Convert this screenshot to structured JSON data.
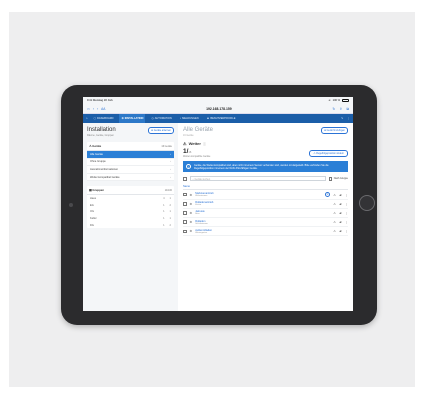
{
  "statusbar": {
    "time": "9:41",
    "date": "Dienstag 18. Feb.",
    "battery": "100 %"
  },
  "browser": {
    "url": "192.168.178.159",
    "aa_label": "AA"
  },
  "nav": {
    "tabs": [
      {
        "label": "DASHBOARD"
      },
      {
        "label": "INSTALLATION",
        "active": true
      },
      {
        "label": "AUTOMATION"
      },
      {
        "label": "MELDUNGEN"
      },
      {
        "label": "BENUTZERPROFILE"
      }
    ]
  },
  "left": {
    "title": "Installation",
    "subtitle": "Räume, Geräte, Gruppen",
    "add_button": "Geräte anlernen",
    "devices_section": {
      "title": "Geräte",
      "meta": "16 Geräte",
      "items": [
        {
          "label": "Alle Geräte",
          "active": true
        },
        {
          "label": "Ohne Gruppe"
        },
        {
          "label": "Ausnahmeinformationen"
        },
        {
          "label": "Wetter kompatibel Geräte"
        }
      ]
    },
    "groups_section": {
      "title": "Gruppen",
      "meta": "14/100",
      "items": [
        {
          "label": "Haus",
          "a": "4",
          "b": "1"
        },
        {
          "label": "EG",
          "a": "1",
          "b": "2"
        },
        {
          "label": "OG",
          "a": "1",
          "b": "1"
        },
        {
          "label": "Keller",
          "a": "1",
          "b": "1"
        },
        {
          "label": "DG",
          "a": "1",
          "b": "2"
        }
      ]
    }
  },
  "right": {
    "title": "Alle Geräte",
    "subtitle": "16 Geräte",
    "add_button": "Gerät hinzufügen",
    "weather_label": "Wetter",
    "counter_value": "1/",
    "counter_total": "16",
    "counter_sublabel": "Wetter-kompatible Geräte",
    "warn_button": "Regelfolgeposition ändern",
    "info_text": "Geräte, die Wetter-kompatibel sind, aber nicht mit einem Sensor verbunden sind, werden rot dargestellt. Bitte verbinden Sie die Regelfolgeposition mit einem der Nicht-Pilot-fähigen Geräte.",
    "filter_placeholder": "Geräte suchen",
    "filter_select": "Nach Gruppe",
    "list_header": "Name",
    "devices": [
      {
        "name": "Markisenantrieb",
        "sub": "Wohnzimmer"
      },
      {
        "name": "Rolladenantrieb",
        "sub": "Küche"
      },
      {
        "name": "Jalousie",
        "sub": "Büro"
      },
      {
        "name": "Rolladen",
        "sub": "Schlafzimmer"
      },
      {
        "name": "Außenrolladen",
        "sub": "Wintergarten"
      }
    ]
  },
  "colors": {
    "nav": "#1b5ea8",
    "accent": "#2b7fd6",
    "link": "#2b73d6"
  }
}
